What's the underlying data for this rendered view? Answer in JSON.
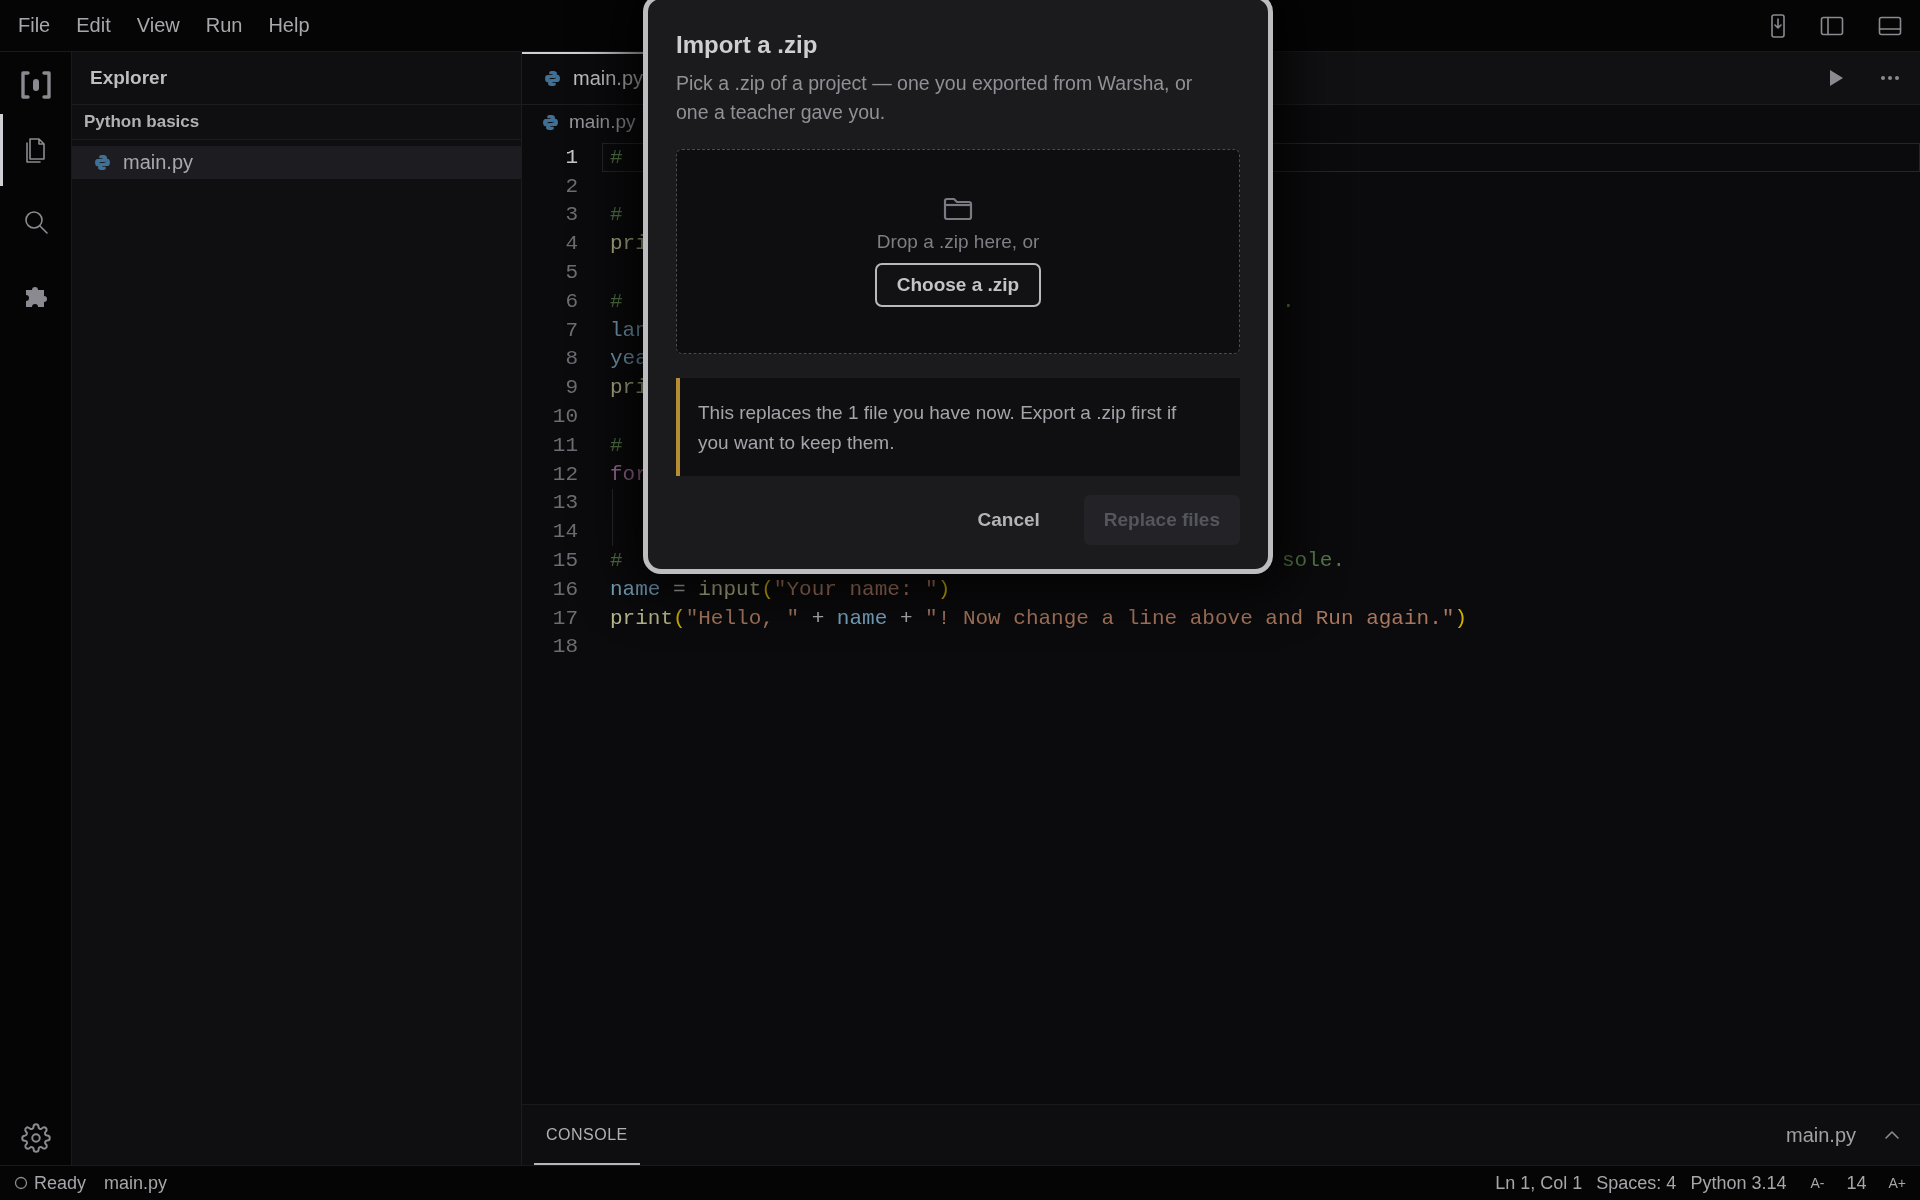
{
  "menu": [
    "File",
    "Edit",
    "View",
    "Run",
    "Help"
  ],
  "activity_bar": [
    {
      "kind": "files",
      "selected": true
    },
    {
      "kind": "search",
      "selected": false
    },
    {
      "kind": "extensions",
      "selected": false
    }
  ],
  "explorer": {
    "title": "Explorer",
    "project": "Python basics",
    "files": [
      {
        "name": "main.py",
        "selected": true
      }
    ]
  },
  "tabs": [
    {
      "label": "main.py",
      "selected": true
    }
  ],
  "breadcrumb": "main.py",
  "code_lines": [
    {
      "number": "1",
      "current": true,
      "guide": false,
      "tokens": [
        {
          "text": "#",
          "kind": "comment"
        }
      ]
    },
    {
      "number": "2",
      "current": false,
      "guide": false
    },
    {
      "number": "3",
      "current": false,
      "guide": false,
      "tokens": [
        {
          "text": "#",
          "kind": "comment"
        }
      ]
    },
    {
      "number": "4",
      "current": false,
      "guide": false,
      "tokens": [
        {
          "text": "pri",
          "kind": "function"
        }
      ]
    },
    {
      "number": "5",
      "current": false,
      "guide": false
    },
    {
      "number": "6",
      "current": false,
      "guide": false,
      "tokens": [
        {
          "text": "#",
          "kind": "comment"
        }
      ],
      "tail": [
        {
          "text": ".",
          "kind": "comment"
        }
      ]
    },
    {
      "number": "7",
      "current": false,
      "guide": false,
      "tokens": [
        {
          "text": "lan",
          "kind": "variable"
        }
      ]
    },
    {
      "number": "8",
      "current": false,
      "guide": false,
      "tokens": [
        {
          "text": "yea",
          "kind": "variable"
        }
      ]
    },
    {
      "number": "9",
      "current": false,
      "guide": false,
      "tokens": [
        {
          "text": "pri",
          "kind": "function"
        }
      ]
    },
    {
      "number": "10",
      "current": false,
      "guide": false
    },
    {
      "number": "11",
      "current": false,
      "guide": false,
      "tokens": [
        {
          "text": "#",
          "kind": "comment"
        }
      ]
    },
    {
      "number": "12",
      "current": false,
      "guide": false,
      "tokens": [
        {
          "text": "for",
          "kind": "keyword"
        }
      ]
    },
    {
      "number": "13",
      "current": false,
      "guide": true
    },
    {
      "number": "14",
      "current": false,
      "guide": true
    },
    {
      "number": "15",
      "current": false,
      "guide": false,
      "tokens": [
        {
          "text": "#",
          "kind": "comment"
        }
      ],
      "tail": [
        {
          "text": "sole.",
          "kind": "comment"
        }
      ]
    },
    {
      "number": "16",
      "current": false,
      "guide": false,
      "tokens": [
        {
          "text": "name",
          "kind": "variable"
        },
        {
          "text": " = ",
          "kind": "plain"
        },
        {
          "text": "input",
          "kind": "function"
        },
        {
          "text": "(",
          "kind": "paren"
        },
        {
          "text": "\"Your name: \"",
          "kind": "string"
        },
        {
          "text": ")",
          "kind": "paren"
        }
      ]
    },
    {
      "number": "17",
      "current": false,
      "guide": false,
      "tokens": [
        {
          "text": "print",
          "kind": "function"
        },
        {
          "text": "(",
          "kind": "paren"
        },
        {
          "text": "\"Hello, \"",
          "kind": "string"
        },
        {
          "text": " + ",
          "kind": "plain"
        },
        {
          "text": "name",
          "kind": "variable"
        },
        {
          "text": " + ",
          "kind": "plain"
        },
        {
          "text": "\"! Now change a line above and Run again.\"",
          "kind": "string"
        },
        {
          "text": ")",
          "kind": "paren"
        }
      ]
    },
    {
      "number": "18",
      "current": false,
      "guide": false
    }
  ],
  "console": {
    "tabs": [
      {
        "label": "CONSOLE",
        "selected": true
      }
    ],
    "file": "main.py"
  },
  "status_bar": {
    "state": "Ready",
    "file": "main.py",
    "position": "Ln 1, Col 1",
    "spaces": "Spaces: 4",
    "language": "Python 3.14",
    "font_smaller": "A-",
    "font_size": "14",
    "font_larger": "A+"
  },
  "dialog": {
    "title": "Import a .zip",
    "description": "Pick a .zip of a project — one you exported from Warsha, or one a teacher gave you.",
    "drop_text": "Drop a .zip here, or",
    "choose_button": "Choose a .zip",
    "warning": "This replaces the 1 file you have now. Export a .zip first if you want to keep them.",
    "buttons": [
      {
        "label": "Cancel",
        "kind": "text",
        "disabled": false
      },
      {
        "label": "Replace files",
        "kind": "primary",
        "disabled": true
      }
    ]
  }
}
